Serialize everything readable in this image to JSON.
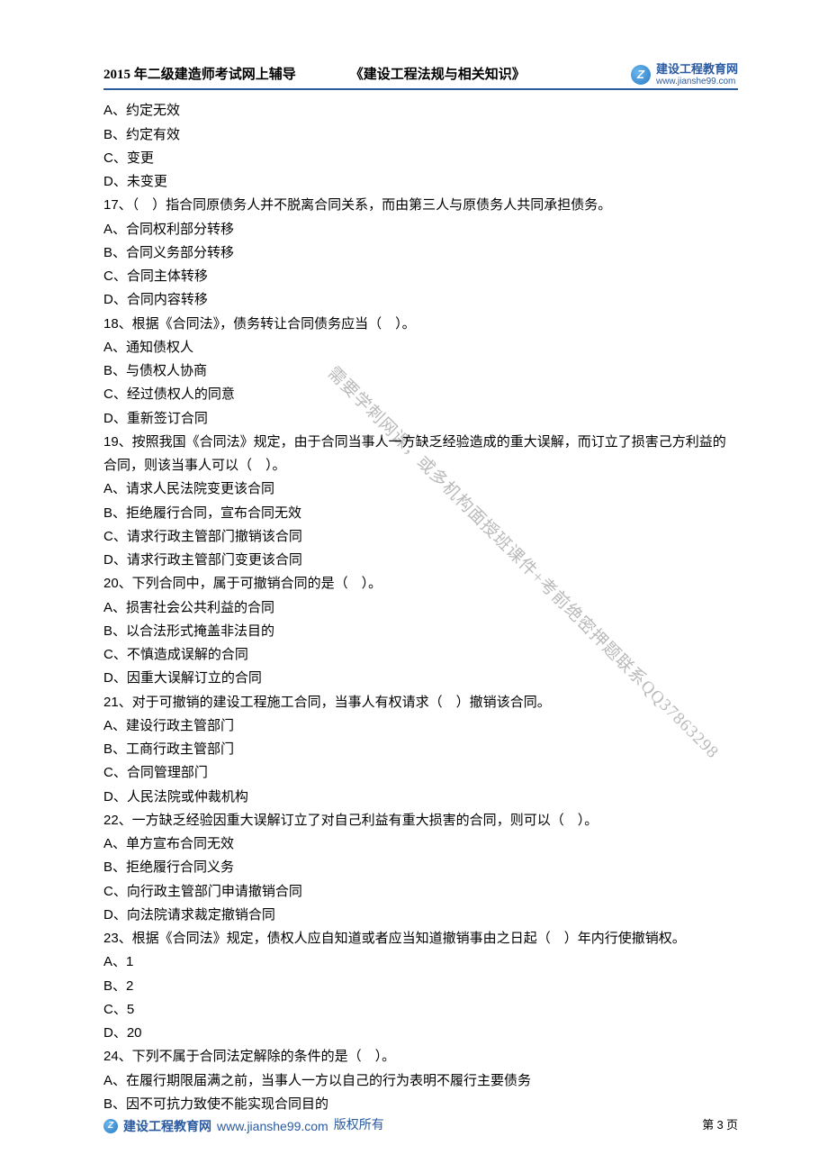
{
  "header": {
    "course_title": "2015 年二级建造师考试网上辅导",
    "book_title": "《建设工程法规与相关知识》",
    "logo_cn": "建设工程教育网",
    "logo_en": "www.jianshe99.com",
    "logo_glyph": "Z"
  },
  "lines": [
    "A、约定无效",
    "B、约定有效",
    "C、变更",
    "D、未变更",
    "17、（　）指合同原债务人并不脱离合同关系，而由第三人与原债务人共同承担债务。",
    "A、合同权利部分转移",
    "B、合同义务部分转移",
    "C、合同主体转移",
    "D、合同内容转移",
    "18、根据《合同法》，债务转让合同债务应当（　）。",
    "A、通知债权人",
    "B、与债权人协商",
    "C、经过债权人的同意",
    "D、重新签订合同",
    "19、按照我国《合同法》规定，由于合同当事人一方缺乏经验造成的重大误解，而订立了损害己方利益的合同，则该当事人可以（　）。",
    "A、请求人民法院变更该合同",
    "B、拒绝履行合同，宣布合同无效",
    "C、请求行政主管部门撤销该合同",
    "D、请求行政主管部门变更该合同",
    "20、下列合同中，属于可撤销合同的是（　）。",
    "A、损害社会公共利益的合同",
    "B、以合法形式掩盖非法目的",
    "C、不慎造成误解的合同",
    "D、因重大误解订立的合同",
    "21、对于可撤销的建设工程施工合同，当事人有权请求（　）撤销该合同。",
    "A、建设行政主管部门",
    "B、工商行政主管部门",
    "C、合同管理部门",
    "D、人民法院或仲裁机构",
    "22、一方缺乏经验因重大误解订立了对自己利益有重大损害的合同，则可以（　）。",
    "A、单方宣布合同无效",
    "B、拒绝履行合同义务",
    "C、向行政主管部门申请撤销合同",
    "D、向法院请求裁定撤销合同",
    "23、根据《合同法》规定，债权人应自知道或者应当知道撤销事由之日起（　）年内行使撤销权。",
    "A、1",
    "B、2",
    "C、5",
    "D、20",
    "24、下列不属于合同法定解除的条件的是（　）。",
    "A、在履行期限届满之前，当事人一方以自己的行为表明不履行主要债务",
    "B、因不可抗力致使不能实现合同目的"
  ],
  "watermark": "需要学刺网课，或多机构面授班课件+考前绝密押题联系QQ37863298",
  "footer": {
    "site_name": "建设工程教育网",
    "url": "www.jianshe99.com",
    "copyright": "版权所有",
    "page_label_prefix": "第 ",
    "page_number": "3",
    "page_label_suffix": " 页",
    "logo_glyph": "Z"
  }
}
